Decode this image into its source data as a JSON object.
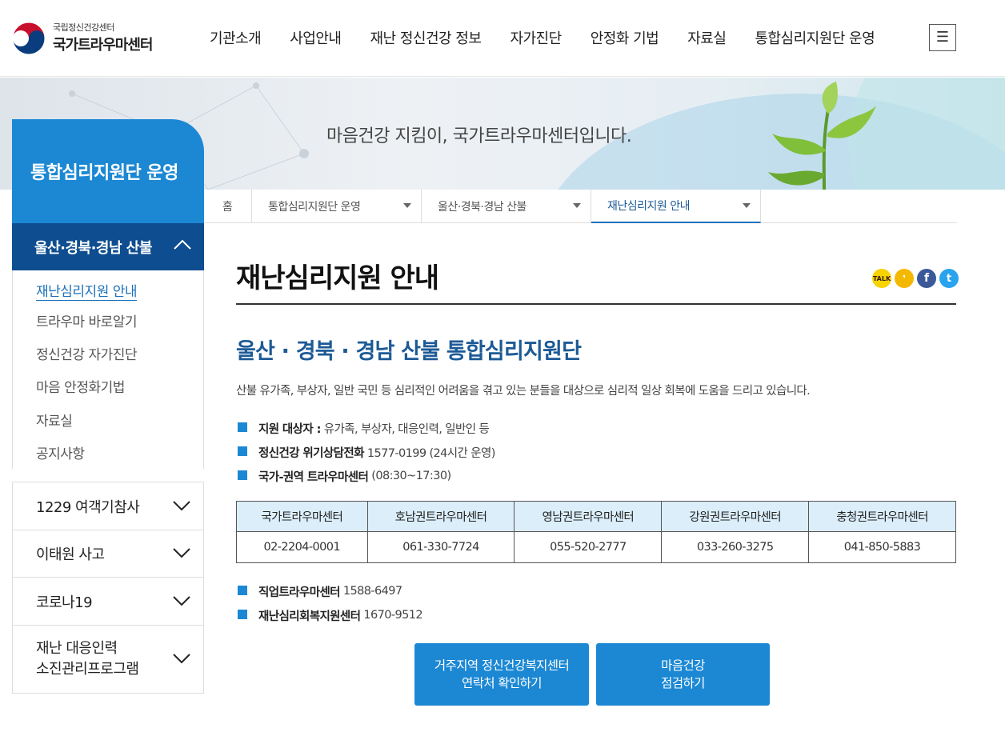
{
  "header": {
    "logo_sub": "국립정신건강센터",
    "logo_main": "국가트라우마센터",
    "nav": [
      "기관소개",
      "사업안내",
      "재난 정신건강 정보",
      "자가진단",
      "안정화 기법",
      "자료실",
      "통합심리지원단 운영"
    ],
    "menu_icon": "☰"
  },
  "banner": {
    "slogan": "마음건강 지킴이, 국가트라우마센터입니다."
  },
  "sidebar": {
    "title": "통합심리지원단 운영",
    "active_group": "울산·경북·경남 산불",
    "sub_items": [
      {
        "label": "재난심리지원 안내"
      },
      {
        "label": "트라우마 바로알기"
      },
      {
        "label": "정신건강 자가진단"
      },
      {
        "label": "마음 안정화기법"
      },
      {
        "label": "자료실"
      },
      {
        "label": "공지사항"
      }
    ],
    "groups": [
      {
        "label": "1229 여객기참사"
      },
      {
        "label": "이태원 사고"
      },
      {
        "label": "코로나19"
      },
      {
        "label_line1": "재난 대응인력",
        "label_line2": "소진관리프로그램"
      }
    ]
  },
  "breadcrumb": {
    "home": "홈",
    "items": [
      "통합심리지원단 운영",
      "울산·경북·경남 산불",
      "재난심리지원 안내"
    ]
  },
  "content": {
    "page_title": "재난심리지원 안내",
    "share": [
      "kakaotalk-icon",
      "kakaostory-icon",
      "facebook-icon",
      "twitter-icon"
    ],
    "sub_title": "울산 · 경북 · 경남 산불 통합심리지원단",
    "description": "산불 유가족, 부상자, 일반 국민 등 심리적인 어려움을 겪고 있는 분들을 대상으로 심리적 일상 회복에 도움을 드리고 있습니다.",
    "bullets": [
      {
        "strong": "지원 대상자 :",
        "text": "유가족, 부상자, 대응인력, 일반인 등"
      },
      {
        "strong": "정신건강 위기상담전화",
        "text": "1577-0199 (24시간 운영)"
      },
      {
        "strong": "국가-권역 트라우마센터",
        "text": "(08:30~17:30)"
      }
    ],
    "table": {
      "headers": [
        "국가트라우마센터",
        "호남권트라우마센터",
        "영남권트라우마센터",
        "강원권트라우마센터",
        "충청권트라우마센터"
      ],
      "phones": [
        "02-2204-0001",
        "061-330-7724",
        "055-520-2777",
        "033-260-3275",
        "041-850-5883"
      ]
    },
    "bullets2": [
      {
        "strong": "직업트라우마센터",
        "text": "1588-6497"
      },
      {
        "strong": "재난심리회복지원센터",
        "text": "1670-9512"
      }
    ],
    "buttons": [
      {
        "line1": "거주지역 정신건강복지센터",
        "line2": "연락처 확인하기"
      },
      {
        "line1": "마음건강",
        "line2": "점검하기"
      }
    ]
  },
  "colors": {
    "primary": "#1c88d4",
    "dark_blue": "#0e4d8f",
    "title_blue": "#1c5a96",
    "table_header": "#dbeefa"
  }
}
